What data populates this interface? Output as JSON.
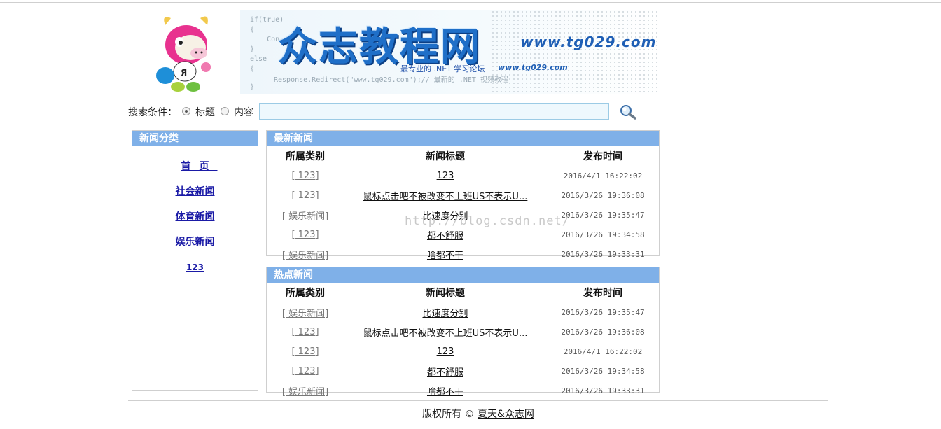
{
  "header": {
    "banner_code_lines": "if(true)\n{\n    Con\n}\nelse\n{",
    "banner_code_tail": "}",
    "brand": "众志教程网",
    "url": "www.tg029.com",
    "tagline": "最专业的 .NET 学习论坛",
    "tagline_url": "www.tg029.com",
    "sub_line": "Response.Redirect(\"www.tg029.com\");// 最新的 .NET 视频教程"
  },
  "search": {
    "label": "搜索条件：",
    "option_title": "标题",
    "option_content": "内容",
    "value": "",
    "selected": "标题"
  },
  "sidebar": {
    "title": "新闻分类",
    "items": [
      {
        "label": "首页"
      },
      {
        "label": "社会新闻"
      },
      {
        "label": "体育新闻"
      },
      {
        "label": "娱乐新闻"
      },
      {
        "label": "123"
      }
    ]
  },
  "latest": {
    "title": "最新新闻",
    "columns": [
      "所属类别",
      "新闻标题",
      "发布时间"
    ],
    "rows": [
      {
        "category": "[ 123]",
        "title": "123",
        "time": "2016/4/1 16:22:02"
      },
      {
        "category": "[ 123]",
        "title": "鼠标点击吧不被改变不上班US不表示U...",
        "time": "2016/3/26 19:36:08"
      },
      {
        "category": "[ 娱乐新闻]",
        "title": "比速度分别",
        "time": "2016/3/26 19:35:47"
      },
      {
        "category": "[ 123]",
        "title": "都不舒服",
        "time": "2016/3/26 19:34:58"
      },
      {
        "category": "[ 娱乐新闻]",
        "title": "啥都不干",
        "time": "2016/3/26 19:33:31"
      }
    ]
  },
  "hot": {
    "title": "热点新闻",
    "columns": [
      "所属类别",
      "新闻标题",
      "发布时间"
    ],
    "rows": [
      {
        "category": "[ 娱乐新闻]",
        "title": "比速度分别",
        "time": "2016/3/26 19:35:47"
      },
      {
        "category": "[ 123]",
        "title": "鼠标点击吧不被改变不上班US不表示U...",
        "time": "2016/3/26 19:36:08"
      },
      {
        "category": "[ 123]",
        "title": "123",
        "time": "2016/4/1 16:22:02"
      },
      {
        "category": "[ 123]",
        "title": "都不舒服",
        "time": "2016/3/26 19:34:58"
      },
      {
        "category": "[ 娱乐新闻]",
        "title": "啥都不干",
        "time": "2016/3/26 19:33:31"
      }
    ]
  },
  "watermark": "http://blog.csdn.net/",
  "footer": {
    "prefix": "版权所有 ©",
    "link": "夏天&众志网"
  },
  "colors": {
    "panel_header": "#7fb0e8",
    "brand_blue": "#1f6fc8",
    "link_blue": "#1a1aa6"
  }
}
